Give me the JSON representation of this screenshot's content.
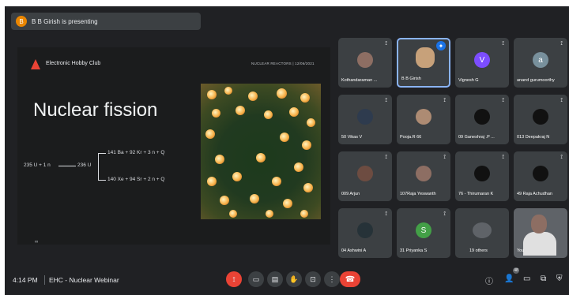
{
  "banner": {
    "text": "B B Girish is presenting",
    "initial": "B"
  },
  "slide": {
    "club_name": "Electronic Hobby Club",
    "subtitle": "NUCLEAR REACTORS | 12/06/2021",
    "title": "Nuclear fission",
    "page_indicator": "∞",
    "equation": {
      "reactant": "235 U + 1 n",
      "intermediate": "236 U",
      "product1": "141 Ba + 92 Kr + 3 n + Q",
      "product2": "140 Xe + 94 Sr + 2 n + Q"
    }
  },
  "participants": [
    {
      "name": "Kothandaraman ...",
      "initial": "",
      "color": "#8d6e63"
    },
    {
      "name": "B B Girish",
      "initial": "",
      "color": "#c7a17a",
      "active": true
    },
    {
      "name": "Vignesh G",
      "initial": "V",
      "color": "#7c4dff"
    },
    {
      "name": "anand gurumoorthy",
      "initial": "a",
      "color": "#78909c"
    },
    {
      "name": "50 Vikas V",
      "initial": "",
      "color": "#2e3b4e"
    },
    {
      "name": "Pooja.R 66",
      "initial": "",
      "color": "#ad8b73"
    },
    {
      "name": "09 Ganeshraj .P ...",
      "initial": "",
      "color": "#111111"
    },
    {
      "name": "013 Deepakraj N",
      "initial": "",
      "color": "#111111"
    },
    {
      "name": "009 Arjun",
      "initial": "",
      "color": "#6d4c41"
    },
    {
      "name": "107Raja Yeswanth",
      "initial": "",
      "color": "#8d6e63"
    },
    {
      "name": "76 - Thirumaran K",
      "initial": "",
      "color": "#111111"
    },
    {
      "name": "49 Raja Achudhan",
      "initial": "",
      "color": "#111111"
    },
    {
      "name": "04 Ashwini A",
      "initial": "",
      "color": "#263238"
    },
    {
      "name": "31 Priyanka S",
      "initial": "S",
      "color": "#43a047"
    },
    {
      "name": "19 others",
      "initial": "",
      "color": "#5f6368"
    },
    {
      "name": "You",
      "initial": "",
      "color": "#5f6368",
      "self": true
    }
  ],
  "bottom": {
    "time": "4:14 PM",
    "meeting_title": "EHC - Nuclear Webinar",
    "notification_count": "48"
  },
  "icons": {
    "mic_off": "mic-off-icon",
    "camera": "camera-icon",
    "captions": "captions-icon",
    "raise_hand": "raise-hand-icon",
    "present": "present-icon",
    "more": "more-icon",
    "leave": "leave-call-icon",
    "info": "info-icon",
    "people": "people-icon",
    "chat": "chat-icon",
    "activities": "activities-icon",
    "security": "security-icon"
  },
  "colors": {
    "accent": "#1a73e8",
    "danger": "#ea4335",
    "bg": "#202124"
  }
}
